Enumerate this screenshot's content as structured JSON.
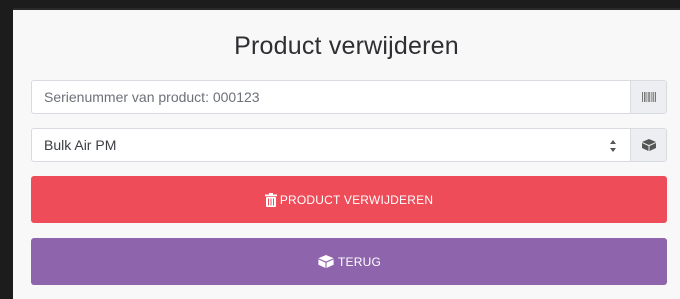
{
  "page": {
    "title": "Product verwijderen"
  },
  "serial": {
    "placeholder": "Serienummer van product: 000123",
    "value": "",
    "addon_icon": "barcode-icon"
  },
  "product_select": {
    "selected": "Bulk Air PM",
    "arrow_icon": "select-arrows-icon",
    "addon_icon": "boxes-icon"
  },
  "buttons": {
    "delete_label": "PRODUCT VERWIJDEREN",
    "delete_icon": "trash-icon",
    "back_label": "TERUG",
    "back_icon": "boxes-icon"
  },
  "colors": {
    "delete": "#ee4c58",
    "back": "#8e65ac"
  }
}
